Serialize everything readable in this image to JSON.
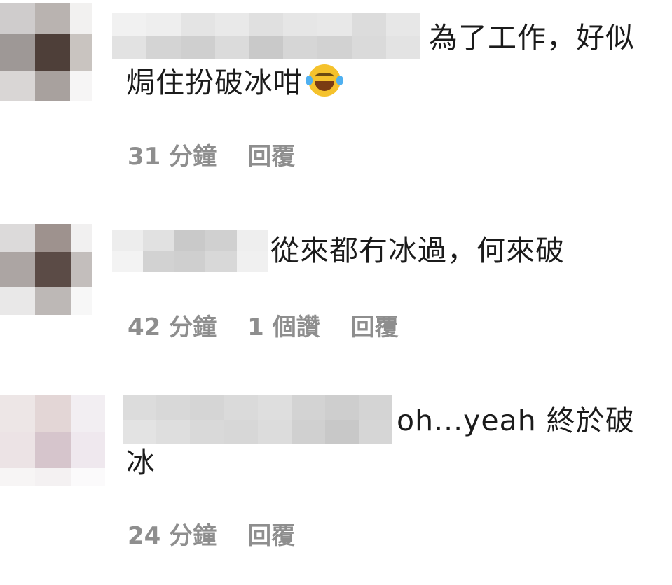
{
  "comments": [
    {
      "text_line1": "為了工作，好似",
      "text_line2": "焗住扮破冰咁",
      "emoji": "face-with-tears-of-joy",
      "time": "31 分鐘",
      "likes": "",
      "reply": "回覆",
      "avatar_colors": [
        "#cfcccc",
        "#b9b3b0",
        "#f2f1f0",
        "#9e9896",
        "#4e3f39",
        "#c9c4c0",
        "#d9d6d5",
        "#a8a19e",
        "#f6f5f5"
      ]
    },
    {
      "text_line1": "從來都冇冰過，何來破",
      "text_line2": "",
      "emoji": "",
      "time": "42 分鐘",
      "likes": "1 個讚",
      "reply": "回覆",
      "avatar_colors": [
        "#dcdada",
        "#9e928e",
        "#f1f0f0",
        "#aca5a3",
        "#5b4b46",
        "#c3bebc",
        "#e9e8e8",
        "#bdb8b6",
        "#f7f7f7"
      ]
    },
    {
      "text_line1": "oh...yeah 終於破",
      "text_line2": "冰",
      "emoji": "",
      "time": "24 分鐘",
      "likes": "",
      "reply": "回覆",
      "avatar_colors": [
        "#ede6e6",
        "#e3d6d6",
        "#f2eef2",
        "#ece3e5",
        "#d6c5cc",
        "#efe8ee",
        "#f7f5f5",
        "#f4f1f2",
        "#fbfafb"
      ]
    }
  ]
}
